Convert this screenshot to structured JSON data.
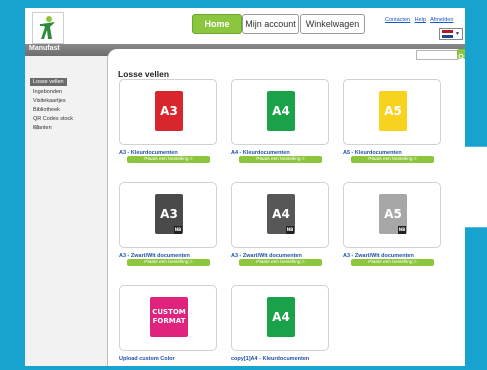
{
  "header": {
    "nav": {
      "home": "Home",
      "account": "Mijn account",
      "cart": "Winkelwagen"
    },
    "links": [
      "Contacten",
      "Help",
      "Afmelden"
    ],
    "language_flag": "nl-flag-icon"
  },
  "site_name": "Manufast",
  "search": {
    "value": ""
  },
  "sidebar": {
    "items": [
      {
        "label": "Losse vellen",
        "active": true
      },
      {
        "label": "Ingebonden"
      },
      {
        "label": "Visitekaartjes"
      },
      {
        "label": "Bibliotheek"
      },
      {
        "label": "QR Codes stock"
      },
      {
        "label": "Klanten",
        "expandable": true
      }
    ]
  },
  "main": {
    "title": "Losse vellen",
    "order_label": "Plaats een bestelling >",
    "products": [
      {
        "code": "A3",
        "name": "A3 - Kleurdocumenten",
        "color": "#d7262e"
      },
      {
        "code": "A4",
        "name": "A4 - Kleurdocumenten",
        "color": "#1aa24a"
      },
      {
        "code": "A5",
        "name": "A5 - Kleurdocumenten",
        "color": "#f7d21f"
      },
      {
        "code": "A3",
        "badge": "NB",
        "name": "A3 - Zwart/Wit documenten",
        "color": "#4a4a4a"
      },
      {
        "code": "A4",
        "badge": "NB",
        "name": "A3 - Zwart/Wit documenten",
        "color": "#575757"
      },
      {
        "code": "A5",
        "badge": "NB",
        "name": "A3 - Zwart/Wit documenten",
        "color": "#a7a7a7"
      },
      {
        "code": "CUSTOM FORMAT",
        "name": "Upload custom Color",
        "color": "#e0237c"
      },
      {
        "code": "A4",
        "name": "copy[1]A4 - Kleurdocumenten",
        "color": "#1aa24a"
      }
    ]
  }
}
